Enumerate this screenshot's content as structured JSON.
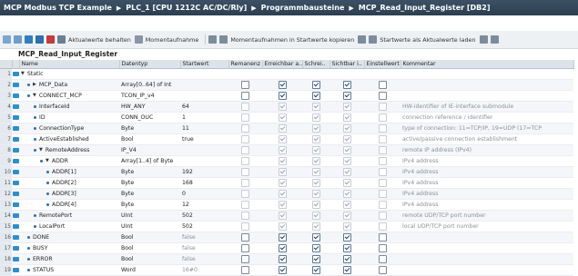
{
  "breadcrumb": {
    "project": "MCP Modbus TCP Example",
    "device": "PLC_1 [CPU 1212C AC/DC/Rly]",
    "folder": "Programmbausteine",
    "block": "MCP_Read_Input_Register [DB2]"
  },
  "toolbar": {
    "keep_actual": "Aktualwerte behalten",
    "snapshot": "Momentaufnahme",
    "copy_snapshot": "Momentaufnahmen in Startwerte kopieren",
    "load_start": "Startwerte als Aktualwerte laden"
  },
  "block_title": "MCP_Read_Input_Register",
  "columns": [
    "Name",
    "Datentyp",
    "Startwert",
    "Remanenz",
    "Erreichbar a..",
    "Schrei..",
    "Sichtbar i..",
    "Einstellwert",
    "Kommentar"
  ],
  "rows": [
    {
      "n": "1",
      "name": "Static",
      "type": "",
      "start": "",
      "indent": 0,
      "tri": "▼",
      "dot": false,
      "rem": null,
      "e": null,
      "w": null,
      "s": null,
      "set": null,
      "dim": false,
      "comment": ""
    },
    {
      "n": "2",
      "name": "MCP_Data",
      "type": "Array[0..64] of Int",
      "start": "",
      "indent": 1,
      "tri": "▶",
      "dot": true,
      "rem": false,
      "e": true,
      "w": true,
      "s": true,
      "set": false,
      "dim": false,
      "comment": ""
    },
    {
      "n": "3",
      "name": "CONNECT_MCP",
      "type": "TCON_IP_v4",
      "start": "",
      "indent": 1,
      "tri": "▼",
      "dot": true,
      "rem": false,
      "e": true,
      "w": true,
      "s": true,
      "set": false,
      "dim": false,
      "comment": ""
    },
    {
      "n": "4",
      "name": "InterfaceId",
      "type": "HW_ANY",
      "start": "64",
      "indent": 2,
      "tri": "",
      "dot": true,
      "rem": false,
      "e": true,
      "w": true,
      "s": true,
      "set": false,
      "dim": true,
      "comment": "HW-identifier of IE-interface submodule"
    },
    {
      "n": "5",
      "name": "ID",
      "type": "CONN_OUC",
      "start": "1",
      "indent": 2,
      "tri": "",
      "dot": true,
      "rem": false,
      "e": true,
      "w": true,
      "s": true,
      "set": false,
      "dim": true,
      "comment": "connection reference / identifier"
    },
    {
      "n": "6",
      "name": "ConnectionType",
      "type": "Byte",
      "start": "11",
      "indent": 2,
      "tri": "",
      "dot": true,
      "rem": false,
      "e": true,
      "w": true,
      "s": true,
      "set": false,
      "dim": true,
      "comment": "type of connection: 11=TCP/IP, 19=UDP (17=TCP"
    },
    {
      "n": "7",
      "name": "ActiveEstablished",
      "type": "Bool",
      "start": "true",
      "indent": 2,
      "tri": "",
      "dot": true,
      "rem": false,
      "e": true,
      "w": true,
      "s": true,
      "set": false,
      "dim": true,
      "comment": "active/passive connection establishment"
    },
    {
      "n": "8",
      "name": "RemoteAddress",
      "type": "IP_V4",
      "start": "",
      "indent": 2,
      "tri": "▼",
      "dot": true,
      "rem": false,
      "e": true,
      "w": true,
      "s": true,
      "set": false,
      "dim": true,
      "comment": "remote IP address (IPv4)"
    },
    {
      "n": "9",
      "name": "ADDR",
      "type": "Array[1..4] of Byte",
      "start": "",
      "indent": 3,
      "tri": "▼",
      "dot": true,
      "rem": false,
      "e": true,
      "w": true,
      "s": true,
      "set": false,
      "dim": true,
      "comment": "IPv4 address"
    },
    {
      "n": "10",
      "name": "ADDR[1]",
      "type": "Byte",
      "start": "192",
      "indent": 4,
      "tri": "",
      "dot": true,
      "rem": false,
      "e": true,
      "w": true,
      "s": true,
      "set": false,
      "dim": true,
      "comment": "IPv4 address"
    },
    {
      "n": "11",
      "name": "ADDR[2]",
      "type": "Byte",
      "start": "168",
      "indent": 4,
      "tri": "",
      "dot": true,
      "rem": false,
      "e": true,
      "w": true,
      "s": true,
      "set": false,
      "dim": true,
      "comment": "IPv4 address"
    },
    {
      "n": "12",
      "name": "ADDR[3]",
      "type": "Byte",
      "start": "0",
      "indent": 4,
      "tri": "",
      "dot": true,
      "rem": false,
      "e": true,
      "w": true,
      "s": true,
      "set": false,
      "dim": true,
      "comment": "IPv4 address"
    },
    {
      "n": "13",
      "name": "ADDR[4]",
      "type": "Byte",
      "start": "12",
      "indent": 4,
      "tri": "",
      "dot": true,
      "rem": false,
      "e": true,
      "w": true,
      "s": true,
      "set": false,
      "dim": true,
      "comment": "IPv4 address"
    },
    {
      "n": "14",
      "name": "RemotePort",
      "type": "UInt",
      "start": "502",
      "indent": 2,
      "tri": "",
      "dot": true,
      "rem": false,
      "e": true,
      "w": true,
      "s": true,
      "set": false,
      "dim": true,
      "comment": "remote UDP/TCP port number"
    },
    {
      "n": "15",
      "name": "LocalPort",
      "type": "UInt",
      "start": "502",
      "indent": 2,
      "tri": "",
      "dot": true,
      "rem": false,
      "e": true,
      "w": true,
      "s": true,
      "set": false,
      "dim": true,
      "comment": "local UDP/TCP port number"
    },
    {
      "n": "16",
      "name": "DONE",
      "type": "Bool",
      "start": "false",
      "indent": 1,
      "tri": "",
      "dot": true,
      "rem": false,
      "e": true,
      "w": true,
      "s": true,
      "set": false,
      "dim": false,
      "comment": ""
    },
    {
      "n": "17",
      "name": "BUSY",
      "type": "Bool",
      "start": "false",
      "indent": 1,
      "tri": "",
      "dot": true,
      "rem": false,
      "e": true,
      "w": true,
      "s": true,
      "set": false,
      "dim": false,
      "comment": ""
    },
    {
      "n": "18",
      "name": "ERROR",
      "type": "Bool",
      "start": "false",
      "indent": 1,
      "tri": "",
      "dot": true,
      "rem": false,
      "e": true,
      "w": true,
      "s": true,
      "set": false,
      "dim": false,
      "comment": ""
    },
    {
      "n": "19",
      "name": "STATUS",
      "type": "Word",
      "start": "16#0",
      "indent": 1,
      "tri": "",
      "dot": true,
      "rem": false,
      "e": true,
      "w": true,
      "s": true,
      "set": false,
      "dim": false,
      "comment": ""
    }
  ]
}
